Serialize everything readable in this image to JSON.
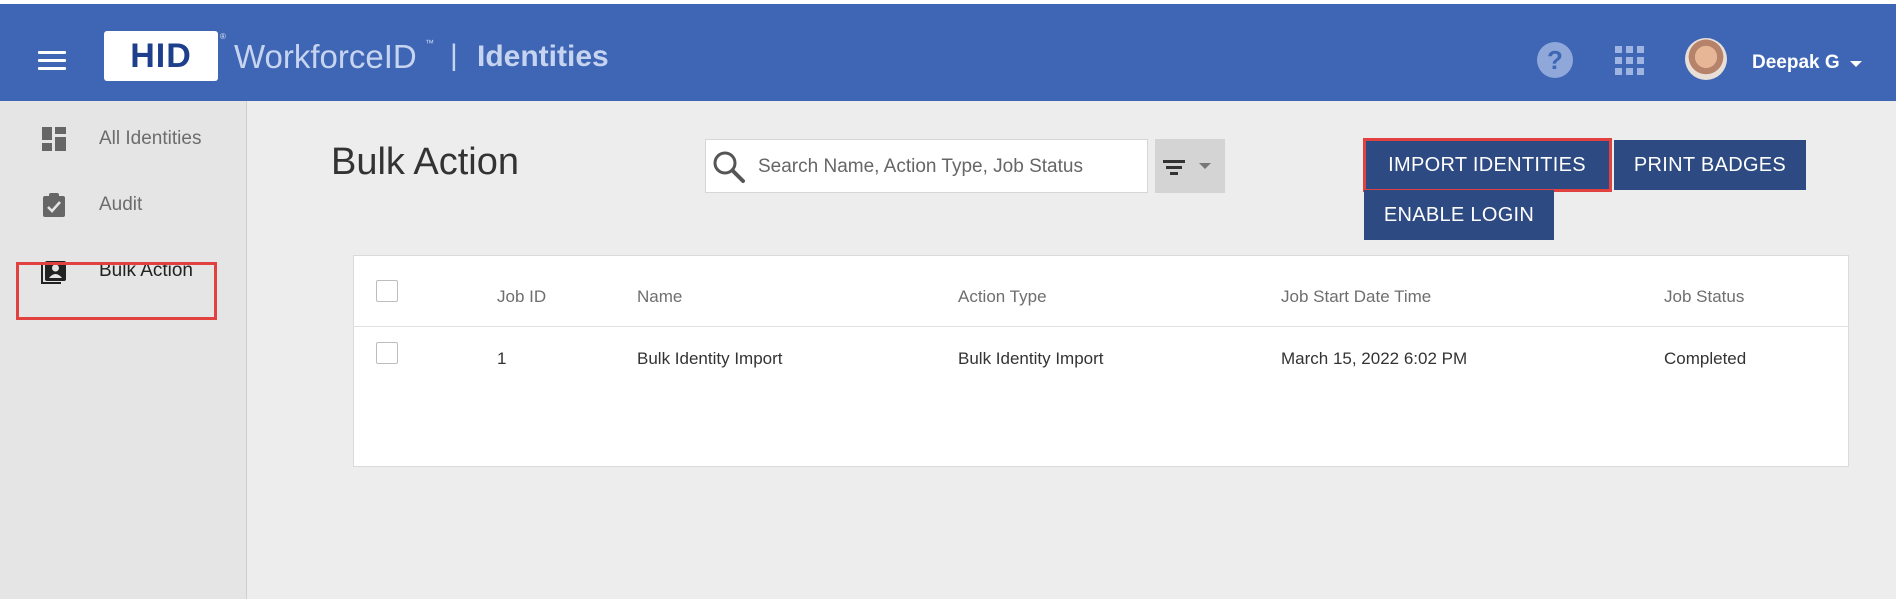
{
  "header": {
    "logo": "HID",
    "logo_reg": "®",
    "brand": "WorkforceID",
    "brand_tm": "™",
    "separator": "|",
    "product": "Identities",
    "help_symbol": "?",
    "user_name": "Deepak G",
    "background_color": "#3e66b5"
  },
  "sidebar": {
    "items": [
      {
        "label": "All Identities",
        "icon": "dashboard-icon",
        "active": false
      },
      {
        "label": "Audit",
        "icon": "clipboard-check-icon",
        "active": false
      },
      {
        "label": "Bulk Action",
        "icon": "contact-clipboard-icon",
        "active": true
      }
    ]
  },
  "main": {
    "title": "Bulk Action",
    "search": {
      "placeholder": "Search Name, Action Type, Job Status",
      "value": ""
    },
    "buttons": {
      "import": "IMPORT IDENTITIES",
      "print": "PRINT BADGES",
      "enable_login": "ENABLE LOGIN"
    },
    "button_color": "#2d4a82",
    "highlight_color": "#e1413f",
    "table": {
      "headers": [
        "Job ID",
        "Name",
        "Action Type",
        "Job Start Date Time",
        "Job Status"
      ],
      "rows": [
        {
          "job_id": "1",
          "name": "Bulk Identity Import",
          "action_type": "Bulk Identity Import",
          "start": "March 15, 2022 6:02 PM",
          "status": "Completed"
        }
      ]
    }
  }
}
